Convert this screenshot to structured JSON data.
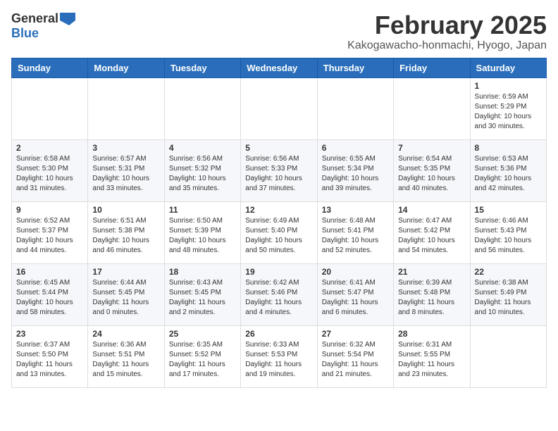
{
  "logo": {
    "general": "General",
    "blue": "Blue"
  },
  "header": {
    "month": "February 2025",
    "location": "Kakogawacho-honmachi, Hyogo, Japan"
  },
  "weekdays": [
    "Sunday",
    "Monday",
    "Tuesday",
    "Wednesday",
    "Thursday",
    "Friday",
    "Saturday"
  ],
  "weeks": [
    [
      {
        "day": "",
        "info": ""
      },
      {
        "day": "",
        "info": ""
      },
      {
        "day": "",
        "info": ""
      },
      {
        "day": "",
        "info": ""
      },
      {
        "day": "",
        "info": ""
      },
      {
        "day": "",
        "info": ""
      },
      {
        "day": "1",
        "info": "Sunrise: 6:59 AM\nSunset: 5:29 PM\nDaylight: 10 hours\nand 30 minutes."
      }
    ],
    [
      {
        "day": "2",
        "info": "Sunrise: 6:58 AM\nSunset: 5:30 PM\nDaylight: 10 hours\nand 31 minutes."
      },
      {
        "day": "3",
        "info": "Sunrise: 6:57 AM\nSunset: 5:31 PM\nDaylight: 10 hours\nand 33 minutes."
      },
      {
        "day": "4",
        "info": "Sunrise: 6:56 AM\nSunset: 5:32 PM\nDaylight: 10 hours\nand 35 minutes."
      },
      {
        "day": "5",
        "info": "Sunrise: 6:56 AM\nSunset: 5:33 PM\nDaylight: 10 hours\nand 37 minutes."
      },
      {
        "day": "6",
        "info": "Sunrise: 6:55 AM\nSunset: 5:34 PM\nDaylight: 10 hours\nand 39 minutes."
      },
      {
        "day": "7",
        "info": "Sunrise: 6:54 AM\nSunset: 5:35 PM\nDaylight: 10 hours\nand 40 minutes."
      },
      {
        "day": "8",
        "info": "Sunrise: 6:53 AM\nSunset: 5:36 PM\nDaylight: 10 hours\nand 42 minutes."
      }
    ],
    [
      {
        "day": "9",
        "info": "Sunrise: 6:52 AM\nSunset: 5:37 PM\nDaylight: 10 hours\nand 44 minutes."
      },
      {
        "day": "10",
        "info": "Sunrise: 6:51 AM\nSunset: 5:38 PM\nDaylight: 10 hours\nand 46 minutes."
      },
      {
        "day": "11",
        "info": "Sunrise: 6:50 AM\nSunset: 5:39 PM\nDaylight: 10 hours\nand 48 minutes."
      },
      {
        "day": "12",
        "info": "Sunrise: 6:49 AM\nSunset: 5:40 PM\nDaylight: 10 hours\nand 50 minutes."
      },
      {
        "day": "13",
        "info": "Sunrise: 6:48 AM\nSunset: 5:41 PM\nDaylight: 10 hours\nand 52 minutes."
      },
      {
        "day": "14",
        "info": "Sunrise: 6:47 AM\nSunset: 5:42 PM\nDaylight: 10 hours\nand 54 minutes."
      },
      {
        "day": "15",
        "info": "Sunrise: 6:46 AM\nSunset: 5:43 PM\nDaylight: 10 hours\nand 56 minutes."
      }
    ],
    [
      {
        "day": "16",
        "info": "Sunrise: 6:45 AM\nSunset: 5:44 PM\nDaylight: 10 hours\nand 58 minutes."
      },
      {
        "day": "17",
        "info": "Sunrise: 6:44 AM\nSunset: 5:45 PM\nDaylight: 11 hours\nand 0 minutes."
      },
      {
        "day": "18",
        "info": "Sunrise: 6:43 AM\nSunset: 5:45 PM\nDaylight: 11 hours\nand 2 minutes."
      },
      {
        "day": "19",
        "info": "Sunrise: 6:42 AM\nSunset: 5:46 PM\nDaylight: 11 hours\nand 4 minutes."
      },
      {
        "day": "20",
        "info": "Sunrise: 6:41 AM\nSunset: 5:47 PM\nDaylight: 11 hours\nand 6 minutes."
      },
      {
        "day": "21",
        "info": "Sunrise: 6:39 AM\nSunset: 5:48 PM\nDaylight: 11 hours\nand 8 minutes."
      },
      {
        "day": "22",
        "info": "Sunrise: 6:38 AM\nSunset: 5:49 PM\nDaylight: 11 hours\nand 10 minutes."
      }
    ],
    [
      {
        "day": "23",
        "info": "Sunrise: 6:37 AM\nSunset: 5:50 PM\nDaylight: 11 hours\nand 13 minutes."
      },
      {
        "day": "24",
        "info": "Sunrise: 6:36 AM\nSunset: 5:51 PM\nDaylight: 11 hours\nand 15 minutes."
      },
      {
        "day": "25",
        "info": "Sunrise: 6:35 AM\nSunset: 5:52 PM\nDaylight: 11 hours\nand 17 minutes."
      },
      {
        "day": "26",
        "info": "Sunrise: 6:33 AM\nSunset: 5:53 PM\nDaylight: 11 hours\nand 19 minutes."
      },
      {
        "day": "27",
        "info": "Sunrise: 6:32 AM\nSunset: 5:54 PM\nDaylight: 11 hours\nand 21 minutes."
      },
      {
        "day": "28",
        "info": "Sunrise: 6:31 AM\nSunset: 5:55 PM\nDaylight: 11 hours\nand 23 minutes."
      },
      {
        "day": "",
        "info": ""
      }
    ]
  ]
}
